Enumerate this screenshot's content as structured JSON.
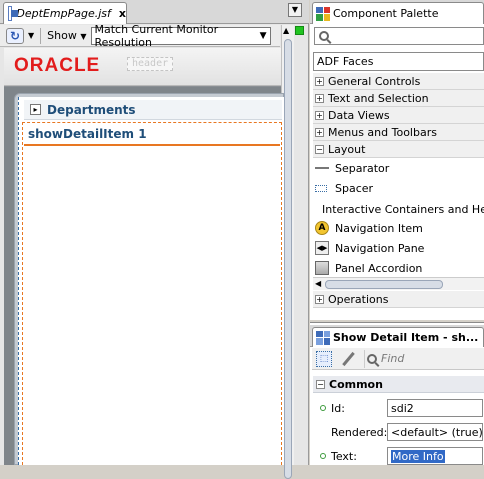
{
  "editor": {
    "file_tab": "DeptEmpPage.jsf",
    "file_tab_close": "x",
    "toolbar": {
      "show_label": "Show",
      "monitor_resolution": "Match Current Monitor Resolution"
    },
    "canvas": {
      "logo_text": "ORACLE",
      "header_facet": "header",
      "departments_label": "Departments",
      "detail_item_label": "showDetailItem 1"
    }
  },
  "palette": {
    "tab_label": "Component Palette",
    "library": "ADF Faces",
    "categories_top": [
      {
        "label": "General Controls",
        "toggle": "+"
      },
      {
        "label": "Text and Selection",
        "toggle": "+"
      },
      {
        "label": "Data Views",
        "toggle": "+"
      },
      {
        "label": "Menus and Toolbars",
        "toggle": "+"
      },
      {
        "label": "Layout",
        "toggle": "−"
      }
    ],
    "layout_items": [
      {
        "label": "Separator",
        "icon": "separator-icon"
      },
      {
        "label": "Spacer",
        "icon": "spacer-icon"
      }
    ],
    "subgroup_label": "Interactive Containers and Headers",
    "interactive_items": [
      {
        "label": "Navigation Item",
        "icon": "navigation-item-icon"
      },
      {
        "label": "Navigation Pane",
        "icon": "navigation-pane-icon"
      },
      {
        "label": "Panel Accordion",
        "icon": "panel-accordion-icon"
      }
    ],
    "category_bottom": {
      "label": "Operations",
      "toggle": "+"
    }
  },
  "inspector": {
    "tab_label": "Show Detail Item - sh...",
    "find_placeholder": "Find",
    "section_label": "Common",
    "section_toggle": "−",
    "properties": [
      {
        "label": "Id:",
        "value": "sdi2"
      },
      {
        "label": "Rendered:",
        "value": "<default> (true)"
      },
      {
        "label": "Text:",
        "value": "More Info"
      }
    ]
  },
  "colors": {
    "oracle_red": "#e21c1c",
    "link_blue": "#1f4e79",
    "selection_orange": "#e87722",
    "highlight_blue": "#3169c6",
    "status_green": "#21c421"
  }
}
